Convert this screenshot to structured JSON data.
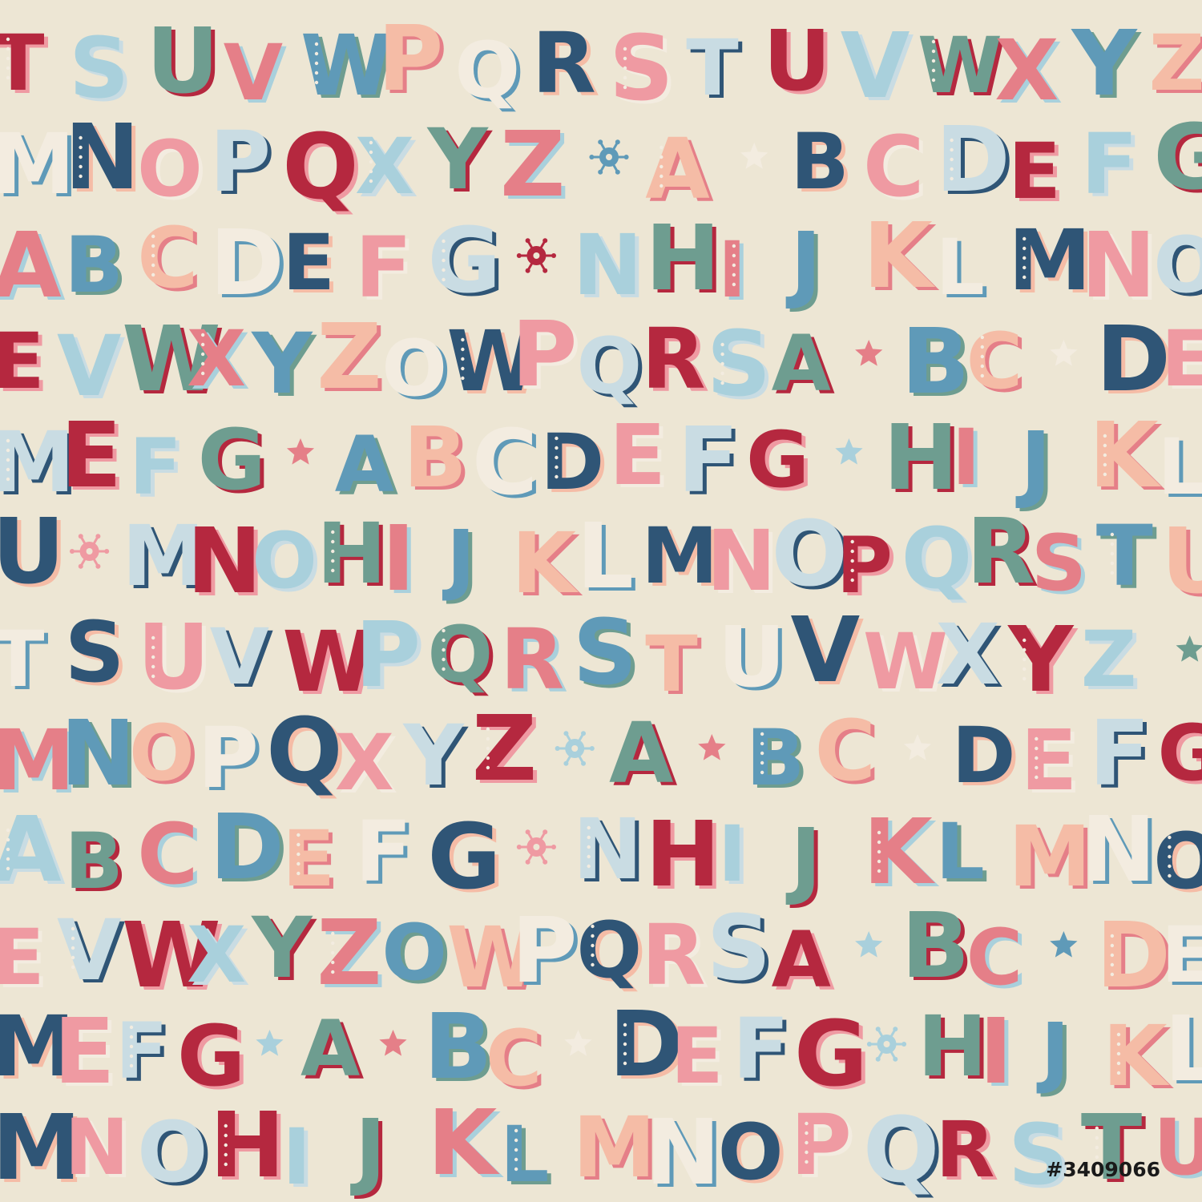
{
  "pattern": {
    "background": "#ede6d4",
    "palette": [
      "#b5283f",
      "#2f5576",
      "#5f9ab8",
      "#a9d0dc",
      "#ef9aa2",
      "#f5bca6",
      "#6e9d90",
      "#c9dce3",
      "#f3ece0",
      "#e57f88"
    ],
    "rows": [
      "TSUVWPQRSTUVWXYZ",
      "MNOPQXYZ*A*BCDEFG",
      "ABCDEFG*NHIJKLMNO",
      "EVWXYZOWPQRSA*BC*DE",
      "MEFG*ABCDEFG*HIJKL",
      "U*MNOHIJKLMNOPQRSTU",
      "TSUVWPQRSTUVWXYZ*",
      "MNOPQXYZ*A*BC*DEFG",
      "ABCDEFG*NHIJKLMNO",
      "EVWXYZOWPQRSA*BC*DE",
      "MEFG*A*BC*DEFG*HIJKL",
      "MNOHIJKLMNOPQRSTU"
    ],
    "star_icon": "star-icon",
    "flower_icon": "snowflake-flower-icon"
  },
  "stock_id": "#3409066"
}
